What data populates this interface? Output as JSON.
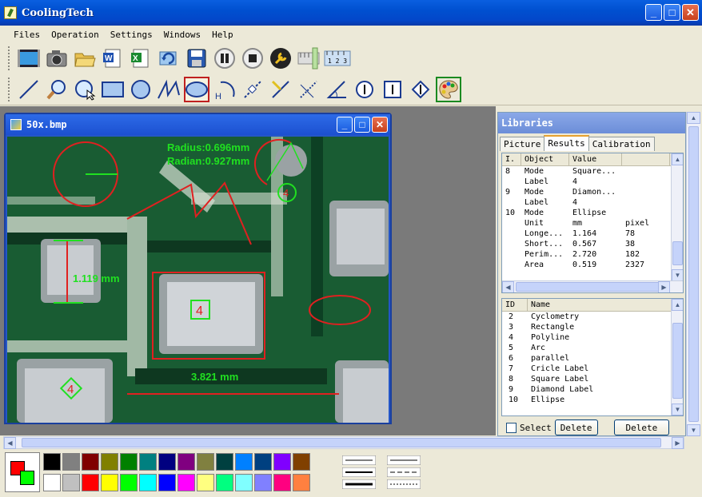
{
  "app": {
    "title": "CoolingTech"
  },
  "window_buttons": {
    "min": "_",
    "max": "□",
    "close": "✕"
  },
  "menu": [
    "Files",
    "Operation",
    "Settings",
    "Windows",
    "Help"
  ],
  "toolbar1": [
    "video-icon",
    "camera-icon",
    "open-folder-icon",
    "word-icon",
    "excel-icon",
    "refresh-icon",
    "save-icon",
    "pause-icon",
    "stop-icon",
    "wrench-icon",
    "ruler-vertical-icon",
    "ruler-horizontal-icon"
  ],
  "toolbar2": [
    "line-icon",
    "zoom-icon",
    "circle-select-icon",
    "rectangle-icon",
    "circle-icon",
    "polyline-icon",
    "ellipse-icon",
    "height-arc-icon",
    "parallel-icon",
    "angle-line-icon",
    "distance-icon",
    "angle-icon",
    "circle-label-icon",
    "square-label-icon",
    "diamond-label-icon",
    "palette-icon"
  ],
  "ruler_label": "1 2 3",
  "height_label": "H",
  "image_window": {
    "title": "50x.bmp",
    "annotations": {
      "radius": "Radius:0.696mm",
      "radian": "Radian:0.927mm",
      "length_vertical": "1.119 mm",
      "length_horizontal": "3.821 mm",
      "label_square": "4",
      "label_circle": "4",
      "label_diamond": "4"
    }
  },
  "libraries": {
    "title": "Libraries",
    "tabs": [
      "Picture",
      "Results",
      "Calibration"
    ],
    "active_tab": "Results",
    "results_headers": [
      "I.",
      "Object",
      "Value",
      ""
    ],
    "results_rows": [
      [
        "8",
        "Mode",
        "Square...",
        ""
      ],
      [
        "",
        "Label",
        "4",
        ""
      ],
      [
        "9",
        "Mode",
        "Diamon...",
        ""
      ],
      [
        "",
        "Label",
        "4",
        ""
      ],
      [
        "10",
        "Mode",
        "Ellipse",
        ""
      ],
      [
        "",
        "Unit",
        "mm",
        "pixel"
      ],
      [
        "",
        "Longe...",
        "1.164",
        "78"
      ],
      [
        "",
        "Short...",
        "0.567",
        "38"
      ],
      [
        "",
        "Perim...",
        "2.720",
        "182"
      ],
      [
        "",
        "Area",
        "0.519",
        "2327"
      ]
    ],
    "id_headers": [
      "ID",
      "Name"
    ],
    "id_rows": [
      [
        "2",
        "Cyclometry"
      ],
      [
        "3",
        "Rectangle"
      ],
      [
        "4",
        "Polyline"
      ],
      [
        "5",
        "Arc"
      ],
      [
        "6",
        "parallel"
      ],
      [
        "7",
        "Cricle Label"
      ],
      [
        "8",
        "Square Label"
      ],
      [
        "9",
        "Diamond Label"
      ],
      [
        "10",
        "Ellipse"
      ]
    ],
    "select_label": "Select",
    "delete_label": "Delete",
    "delete2_label": "Delete"
  },
  "palette": {
    "foreground": "#ff0000",
    "background": "#00ff00",
    "row1": [
      "#000000",
      "#808080",
      "#800000",
      "#808000",
      "#008000",
      "#008080",
      "#000080",
      "#800080",
      "#808040",
      "#004040",
      "#0080ff",
      "#004080",
      "#8000ff",
      "#804000"
    ],
    "row2": [
      "#ffffff",
      "#c0c0c0",
      "#ff0000",
      "#ffff00",
      "#00ff00",
      "#00ffff",
      "#0000ff",
      "#ff00ff",
      "#ffff80",
      "#00ff80",
      "#80ffff",
      "#8080ff",
      "#ff0080",
      "#ff8040"
    ]
  }
}
